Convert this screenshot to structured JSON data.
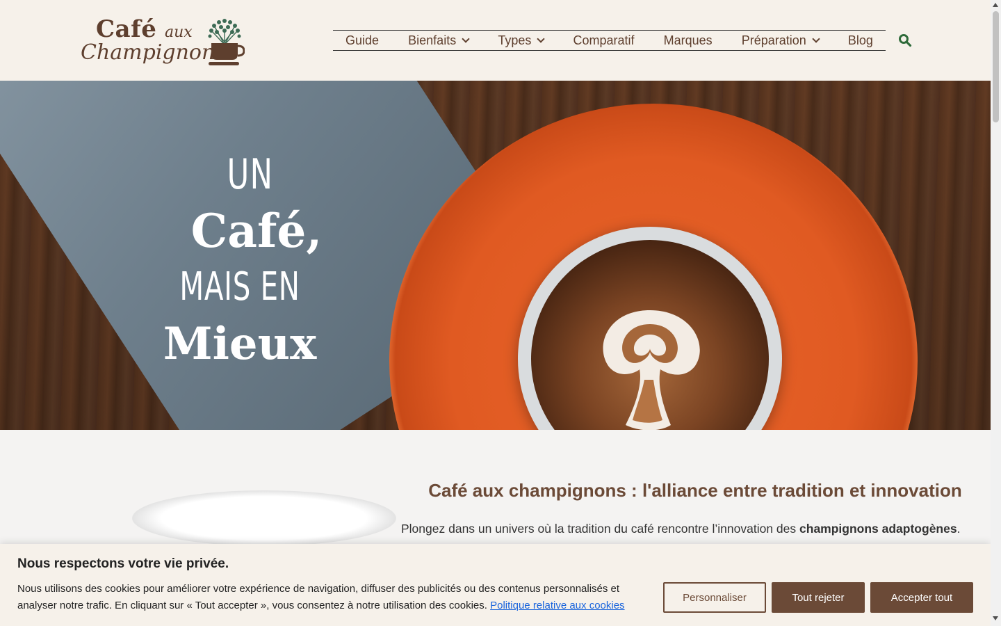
{
  "logo": {
    "line1": "Café",
    "line2": "aux",
    "line3": "Champignons"
  },
  "nav": {
    "items": [
      {
        "label": "Guide",
        "dropdown": false
      },
      {
        "label": "Bienfaits",
        "dropdown": true
      },
      {
        "label": "Types",
        "dropdown": true
      },
      {
        "label": "Comparatif",
        "dropdown": false
      },
      {
        "label": "Marques",
        "dropdown": false
      },
      {
        "label": "Préparation",
        "dropdown": true
      },
      {
        "label": "Blog",
        "dropdown": false
      }
    ],
    "search_icon": "search-icon"
  },
  "hero": {
    "line1": "UN",
    "line2": "Café,",
    "line3": "MAIS EN",
    "line4": "Mieux"
  },
  "content": {
    "title": "Café aux champignons : l'alliance entre tradition et innovation",
    "para_start": "Plongez dans un univers où la tradition du café rencontre l’innovation des ",
    "para_bold": "champignons adaptogènes",
    "para_end": "."
  },
  "cookie": {
    "title": "Nous respectons votre vie privée.",
    "text": "Nous utilisons des cookies pour améliorer votre expérience de navigation, diffuser des publicités ou des contenus personnalisés et analyser notre trafic. En cliquant sur « Tout accepter », vous consentez à notre utilisation des cookies. ",
    "link": "Politique relative aux cookies",
    "btn_customize": "Personnaliser",
    "btn_reject": "Tout rejeter",
    "btn_accept": "Accepter tout"
  },
  "colors": {
    "brand_brown": "#6b4a37",
    "header_bg": "#f6f1ea",
    "link_blue": "#1863dc",
    "search_green": "#2f6b3a"
  }
}
